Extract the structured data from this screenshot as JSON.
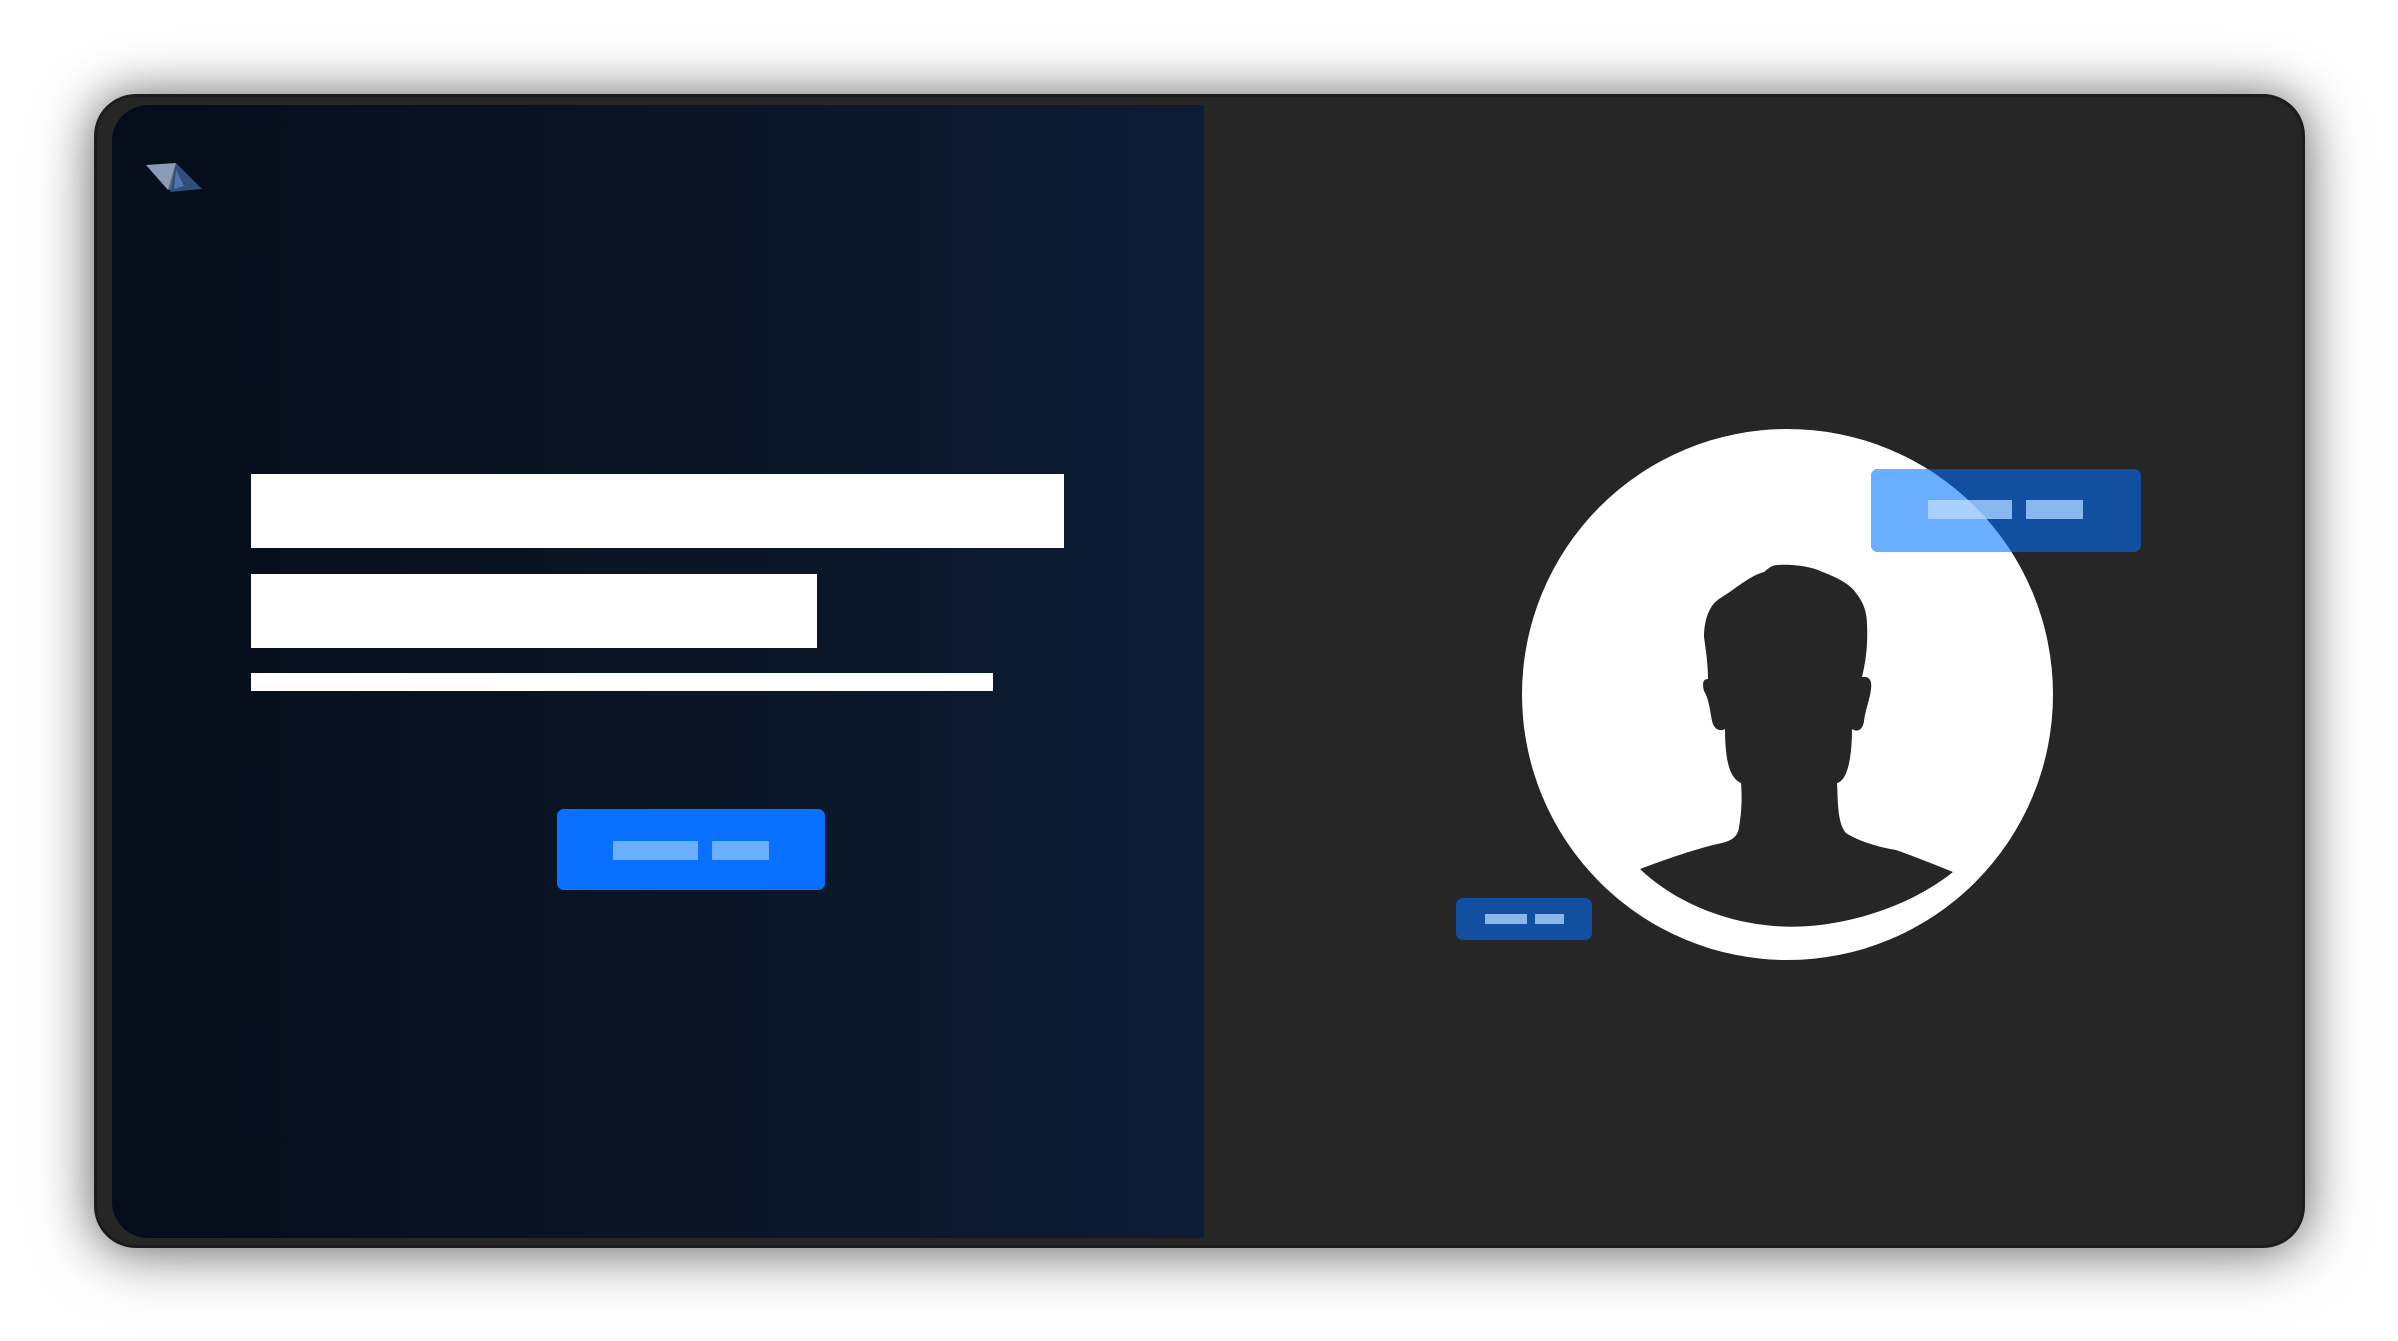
{
  "screen": {
    "left_panel": {
      "logo_icon": "paper-plane-logo-icon",
      "headline_line_1": "",
      "headline_line_2": "",
      "subtitle": "",
      "primary_button_label": ""
    },
    "right_panel": {
      "avatar_icon": "user-silhouette-icon",
      "top_badge_label": "",
      "bottom_badge_label": ""
    }
  },
  "colors": {
    "device_frame": "#262626",
    "left_panel_dark": "#050d1a",
    "left_panel_light": "#0d1c35",
    "primary_button": "#0a70ff",
    "badge": "#124fa0",
    "placeholder_text": "#6bb0ff",
    "avatar_background": "#ffffff",
    "silhouette": "#262626"
  }
}
